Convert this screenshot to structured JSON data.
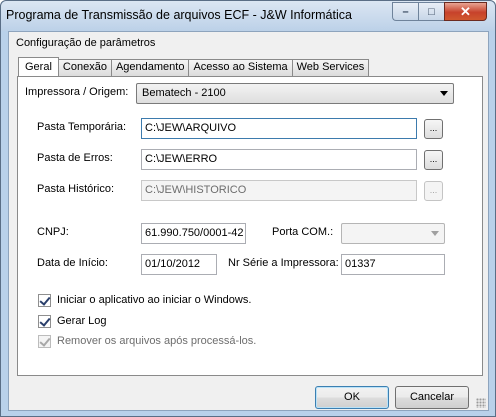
{
  "window": {
    "title": "Programa de Transmissão de arquivos ECF - J&W Informática",
    "minimize_glyph": "–",
    "maximize_glyph": "□",
    "close_glyph": "✕"
  },
  "group": {
    "label": "Configuração de parâmetros"
  },
  "tabs": [
    {
      "label": "Geral",
      "active": true
    },
    {
      "label": "Conexão"
    },
    {
      "label": "Agendamento"
    },
    {
      "label": "Acesso ao Sistema"
    },
    {
      "label": "Web Services"
    }
  ],
  "geral": {
    "impressora_label": "Impressora / Origem:",
    "impressora_value": "Bematech - 2100",
    "pasta_temporaria_label": "Pasta Temporária:",
    "pasta_temporaria_value": "C:\\JEW\\ARQUIVO",
    "pasta_erros_label": "Pasta de Erros:",
    "pasta_erros_value": "C:\\JEW\\ERRO",
    "pasta_historico_label": "Pasta Histórico:",
    "pasta_historico_value": "C:\\JEW\\HISTORICO",
    "browse_label": "...",
    "cnpj_label": "CNPJ:",
    "cnpj_value": "61.990.750/0001-42",
    "porta_com_label": "Porta COM.:",
    "porta_com_value": "",
    "data_inicio_label": "Data de Início:",
    "data_inicio_value": "01/10/2012",
    "nr_serie_label": "Nr Série a Impressora:",
    "nr_serie_value": "01337",
    "chk_iniciar_label": "Iniciar o aplicativo ao iniciar o Windows.",
    "chk_iniciar_checked": true,
    "chk_log_label": "Gerar Log",
    "chk_log_checked": true,
    "chk_remover_label": "Remover os arquivos após processá-los.",
    "chk_remover_checked": true
  },
  "footer": {
    "ok_label": "OK",
    "cancel_label": "Cancelar"
  }
}
